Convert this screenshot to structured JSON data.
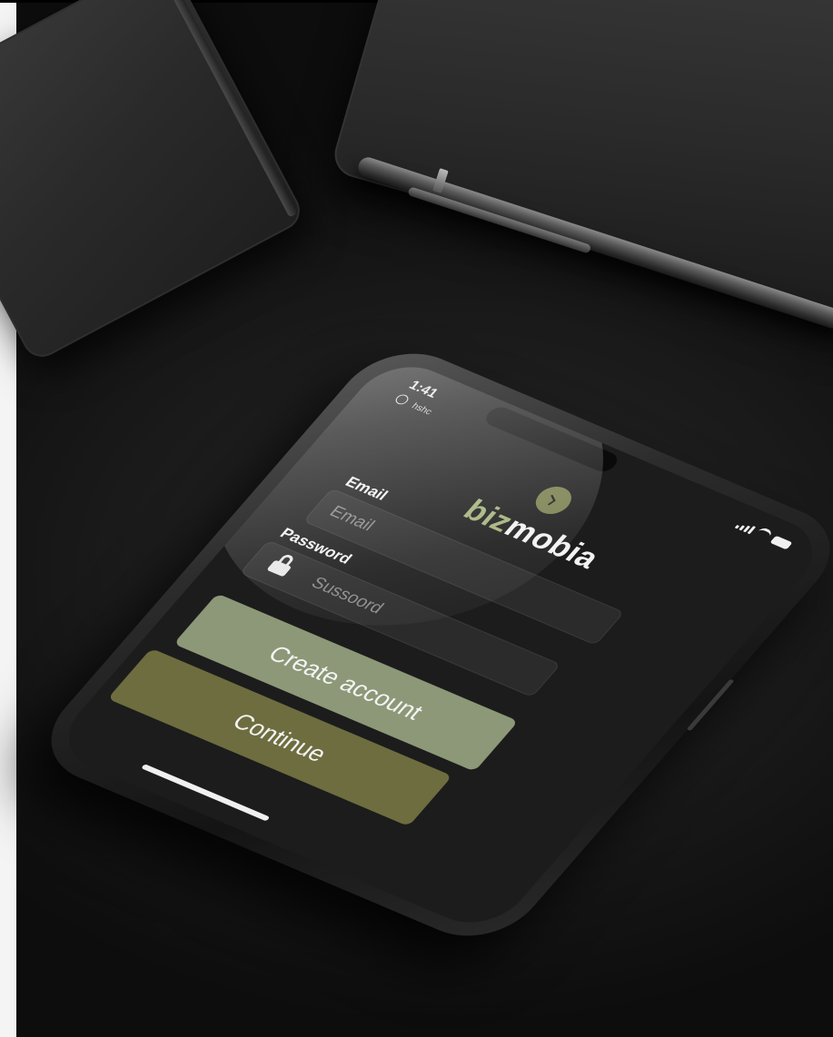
{
  "status_bar": {
    "time": "1:41",
    "carrier": "hshc"
  },
  "app": {
    "logo_part1": "biz",
    "logo_part2": "mobia",
    "brand_color": "#a3b27a"
  },
  "login_form": {
    "email_label": "Email",
    "email_placeholder": "Email",
    "password_label": "Password",
    "password_placeholder": "Sussoord",
    "create_account_label": "Create account",
    "continue_label": "Continue"
  },
  "icons": {
    "lock": "lock-icon",
    "signal": "signal-icon",
    "wifi": "wifi-icon",
    "battery": "battery-icon",
    "logo": "logo-icon"
  },
  "colors": {
    "create_button": "#8c9877",
    "continue_button": "#6d6d3f",
    "screen_background": "#1c1c1c"
  }
}
